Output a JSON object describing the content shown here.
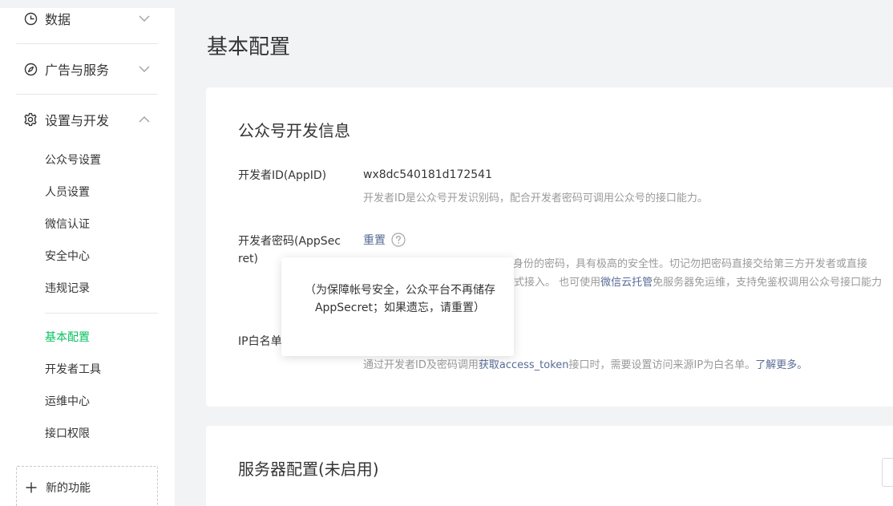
{
  "sidebar": {
    "groups": [
      {
        "label": "数据",
        "icon": "chart-pie-icon",
        "expanded": false
      },
      {
        "label": "广告与服务",
        "icon": "compass-icon",
        "expanded": false
      },
      {
        "label": "设置与开发",
        "icon": "gear-icon",
        "expanded": true
      }
    ],
    "settings_items": [
      {
        "label": "公众号设置"
      },
      {
        "label": "人员设置"
      },
      {
        "label": "微信认证"
      },
      {
        "label": "安全中心"
      },
      {
        "label": "违规记录"
      }
    ],
    "dev_items": [
      {
        "label": "基本配置",
        "active": true
      },
      {
        "label": "开发者工具"
      },
      {
        "label": "运维中心"
      },
      {
        "label": "接口权限"
      }
    ],
    "new_feature_label": "新的功能"
  },
  "page": {
    "title": "基本配置"
  },
  "dev_info": {
    "title": "公众号开发信息",
    "appid_label": "开发者ID(AppID)",
    "appid_value": "wx8dc540181d172541",
    "appid_tip": "开发者ID是公众号开发识别码，配合开发者密码可调用公众号的接口能力。",
    "secret_label": "开发者密码(AppSecret)",
    "secret_reset_link": "重置",
    "secret_tip_line1_visible": "者身份的密码，具有极高的安全性。切记勿把密码直接交给第三方开发者或直接",
    "secret_tip_line2_prefix": "式接入。 也可使用",
    "secret_tip_line2_link": "微信云托管",
    "secret_tip_line2_suffix": "免服务器免运维，支持免鉴权调用公众号接口能力",
    "ip_label": "IP白名单",
    "ip_tip_prefix": "通过开发者ID及密码调用",
    "ip_tip_link": "获取access_token",
    "ip_tip_middle": "接口时，需要设置访问来源IP为白名单。",
    "ip_tip_more": "了解更多。"
  },
  "tooltip": {
    "text": "（为保障帐号安全，公众平台不再储存AppSecret；如果遗忘，请重置）"
  },
  "server_config": {
    "title": "服务器配置(未启用)"
  },
  "colors": {
    "active_green": "#07c160",
    "link_blue": "#576b95",
    "tip_gray": "#9a9a9a",
    "page_bg": "#f2f3f5"
  }
}
